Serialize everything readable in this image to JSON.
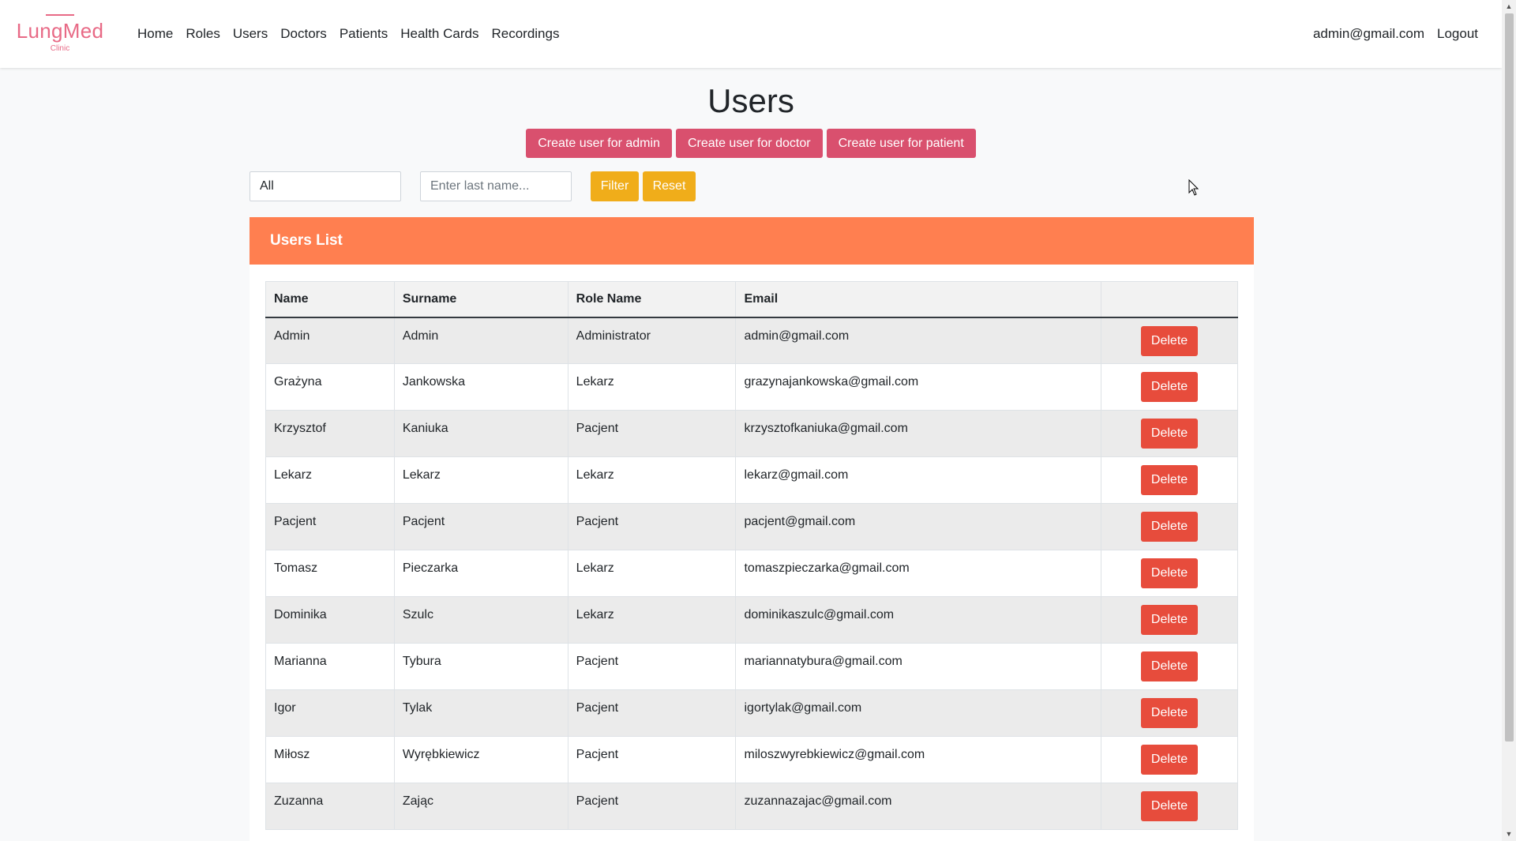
{
  "brand": {
    "name": "LungMed",
    "subtitle": "Clinic",
    "color": "#e86a86"
  },
  "nav": {
    "links": [
      "Home",
      "Roles",
      "Users",
      "Doctors",
      "Patients",
      "Health Cards",
      "Recordings"
    ],
    "user_email": "admin@gmail.com",
    "logout": "Logout"
  },
  "page": {
    "title": "Users",
    "create_buttons": [
      "Create user for admin",
      "Create user for doctor",
      "Create user for patient"
    ]
  },
  "filter": {
    "role_selected": "All",
    "lastname_placeholder": "Enter last name...",
    "filter_label": "Filter",
    "reset_label": "Reset"
  },
  "card": {
    "title": "Users List",
    "header_color": "#ff7f50"
  },
  "table": {
    "headers": [
      "Name",
      "Surname",
      "Role Name",
      "Email",
      ""
    ],
    "delete_label": "Delete",
    "rows": [
      {
        "name": "Admin",
        "surname": "Admin",
        "role": "Administrator",
        "email": "admin@gmail.com"
      },
      {
        "name": "Grażyna",
        "surname": "Jankowska",
        "role": "Lekarz",
        "email": "grazynajankowska@gmail.com"
      },
      {
        "name": "Krzysztof",
        "surname": "Kaniuka",
        "role": "Pacjent",
        "email": "krzysztofkaniuka@gmail.com"
      },
      {
        "name": "Lekarz",
        "surname": "Lekarz",
        "role": "Lekarz",
        "email": "lekarz@gmail.com"
      },
      {
        "name": "Pacjent",
        "surname": "Pacjent",
        "role": "Pacjent",
        "email": "pacjent@gmail.com"
      },
      {
        "name": "Tomasz",
        "surname": "Pieczarka",
        "role": "Lekarz",
        "email": "tomaszpieczarka@gmail.com"
      },
      {
        "name": "Dominika",
        "surname": "Szulc",
        "role": "Lekarz",
        "email": "dominikaszulc@gmail.com"
      },
      {
        "name": "Marianna",
        "surname": "Tybura",
        "role": "Pacjent",
        "email": "mariannatybura@gmail.com"
      },
      {
        "name": "Igor",
        "surname": "Tylak",
        "role": "Pacjent",
        "email": "igortylak@gmail.com"
      },
      {
        "name": "Miłosz",
        "surname": "Wyrębkiewicz",
        "role": "Pacjent",
        "email": "miloszwyrebkiewicz@gmail.com"
      },
      {
        "name": "Zuzanna",
        "surname": "Zając",
        "role": "Pacjent",
        "email": "zuzannazajac@gmail.com"
      }
    ]
  }
}
